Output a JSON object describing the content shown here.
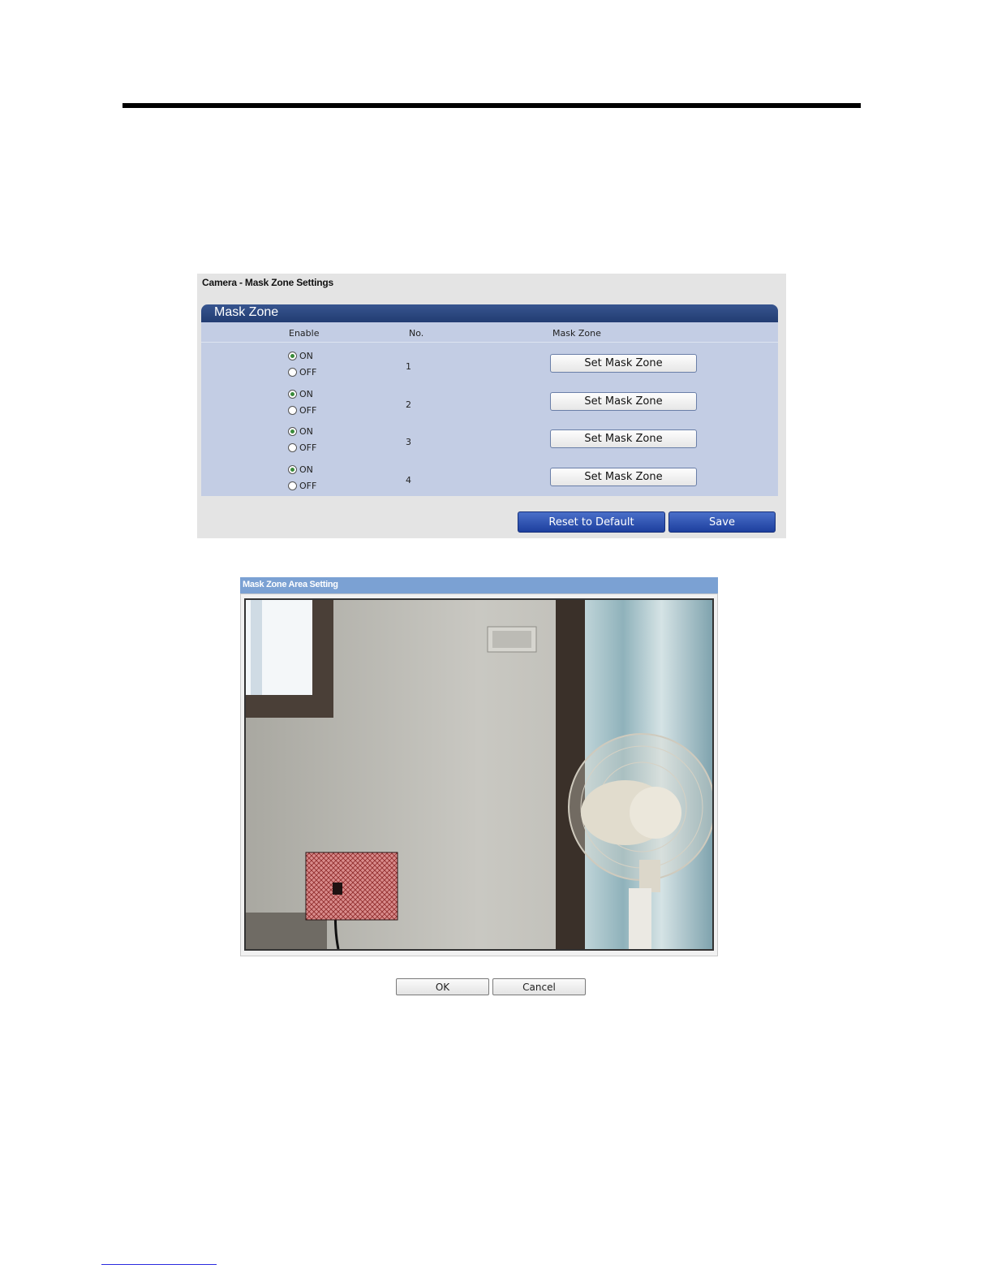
{
  "settings": {
    "page_title": "Camera - Mask Zone Settings",
    "section_title": "Mask Zone",
    "columns": {
      "enable": "Enable",
      "no": "No.",
      "mask_zone": "Mask Zone"
    },
    "rows": [
      {
        "on_label": "ON",
        "off_label": "OFF",
        "enabled": true,
        "no": "1",
        "button": "Set Mask Zone"
      },
      {
        "on_label": "ON",
        "off_label": "OFF",
        "enabled": true,
        "no": "2",
        "button": "Set Mask Zone"
      },
      {
        "on_label": "ON",
        "off_label": "OFF",
        "enabled": true,
        "no": "3",
        "button": "Set Mask Zone"
      },
      {
        "on_label": "ON",
        "off_label": "OFF",
        "enabled": true,
        "no": "4",
        "button": "Set Mask Zone"
      }
    ],
    "reset_label": "Reset to Default",
    "save_label": "Save"
  },
  "area_setting": {
    "title": "Mask Zone Area Setting",
    "ok_label": "OK",
    "cancel_label": "Cancel"
  },
  "colors": {
    "header_blue": "#223c72",
    "table_bg": "#c3cde4",
    "action_button_blue": "#1d3f9e",
    "area_title_bar": "#7ba1d3",
    "mask_zone_fill": "#c0504d"
  }
}
